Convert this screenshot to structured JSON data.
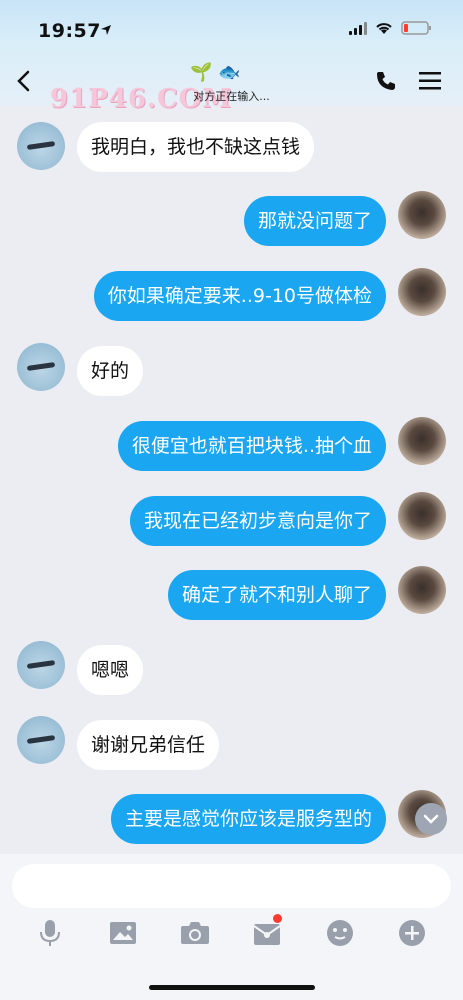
{
  "status_bar": {
    "time": "19:57"
  },
  "header": {
    "watermark": "91P46.COM",
    "emoji": "🌱 🐟",
    "typing": "对方正在输入..."
  },
  "messages": [
    {
      "side": "left",
      "text": "我明白，我也不缺这点钱"
    },
    {
      "side": "right",
      "text": "那就没问题了"
    },
    {
      "side": "right",
      "text": "你如果确定要来..9-10号做体检"
    },
    {
      "side": "left",
      "text": "好的"
    },
    {
      "side": "right",
      "text": "很便宜也就百把块钱..抽个血"
    },
    {
      "side": "right",
      "text": "我现在已经初步意向是你了"
    },
    {
      "side": "right",
      "text": "确定了就不和别人聊了"
    },
    {
      "side": "left",
      "text": "嗯嗯"
    },
    {
      "side": "left",
      "text": "谢谢兄弟信任"
    },
    {
      "side": "right",
      "text": "主要是感觉你应该是服务型的"
    }
  ],
  "toolbar": {
    "icons": [
      "microphone-icon",
      "image-icon",
      "camera-icon",
      "red-packet-icon",
      "emoji-icon",
      "plus-icon"
    ]
  },
  "colors": {
    "accent": "#1aa6f0",
    "badge": "#ff3b30"
  }
}
